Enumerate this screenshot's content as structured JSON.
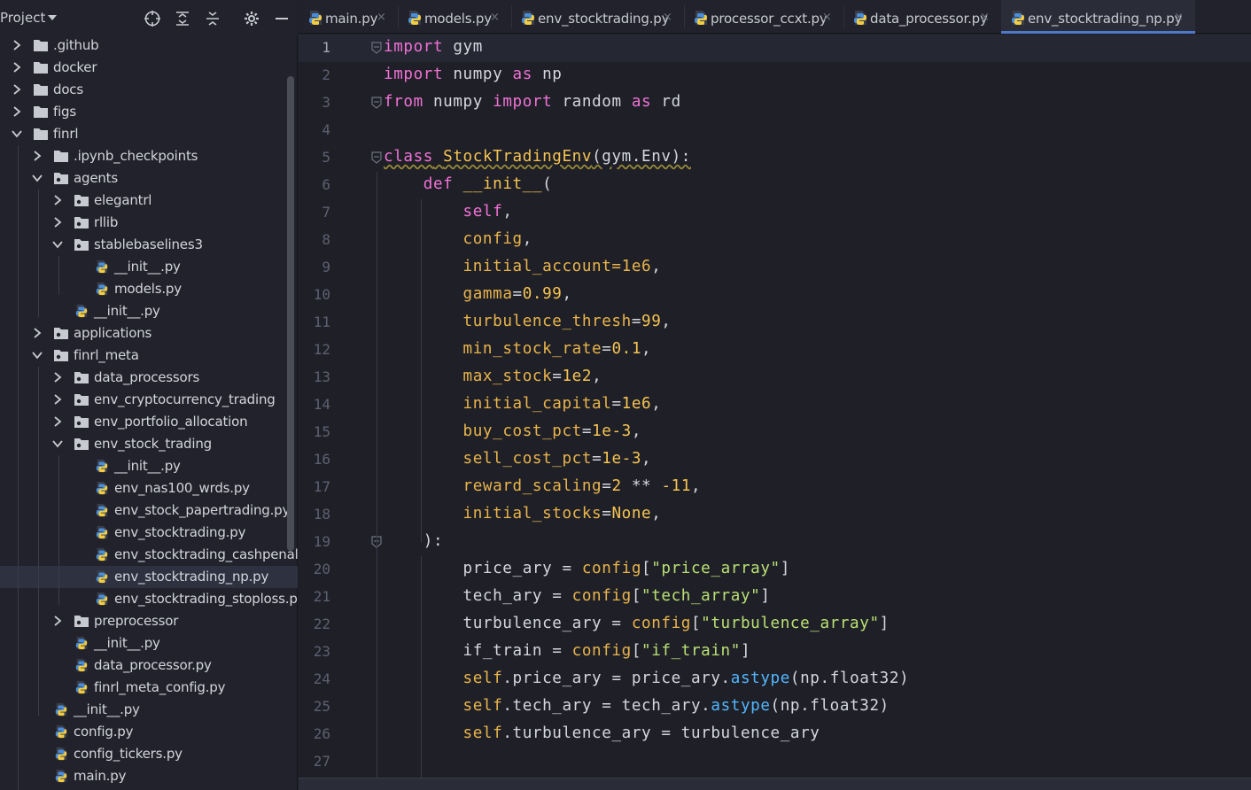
{
  "project": {
    "title": "Project",
    "tree": [
      {
        "label": ".github",
        "type": "folder",
        "level": 0,
        "expanded": false
      },
      {
        "label": "docker",
        "type": "folder",
        "level": 0,
        "expanded": false
      },
      {
        "label": "docs",
        "type": "folder",
        "level": 0,
        "expanded": false
      },
      {
        "label": "figs",
        "type": "folder",
        "level": 0,
        "expanded": false
      },
      {
        "label": "finrl",
        "type": "folder",
        "level": 0,
        "expanded": true
      },
      {
        "label": ".ipynb_checkpoints",
        "type": "folder",
        "level": 1,
        "expanded": false
      },
      {
        "label": "agents",
        "type": "package",
        "level": 1,
        "expanded": true
      },
      {
        "label": "elegantrl",
        "type": "package",
        "level": 2,
        "expanded": false
      },
      {
        "label": "rllib",
        "type": "package",
        "level": 2,
        "expanded": false
      },
      {
        "label": "stablebaselines3",
        "type": "package",
        "level": 2,
        "expanded": true
      },
      {
        "label": "__init__.py",
        "type": "python",
        "level": 3
      },
      {
        "label": "models.py",
        "type": "python",
        "level": 3
      },
      {
        "label": "__init__.py",
        "type": "python",
        "level": 2
      },
      {
        "label": "applications",
        "type": "package",
        "level": 1,
        "expanded": false
      },
      {
        "label": "finrl_meta",
        "type": "package",
        "level": 1,
        "expanded": true
      },
      {
        "label": "data_processors",
        "type": "package",
        "level": 2,
        "expanded": false
      },
      {
        "label": "env_cryptocurrency_trading",
        "type": "package",
        "level": 2,
        "expanded": false
      },
      {
        "label": "env_portfolio_allocation",
        "type": "package",
        "level": 2,
        "expanded": false
      },
      {
        "label": "env_stock_trading",
        "type": "package",
        "level": 2,
        "expanded": true
      },
      {
        "label": "__init__.py",
        "type": "python",
        "level": 3
      },
      {
        "label": "env_nas100_wrds.py",
        "type": "python",
        "level": 3
      },
      {
        "label": "env_stock_papertrading.py",
        "type": "python",
        "level": 3
      },
      {
        "label": "env_stocktrading.py",
        "type": "python",
        "level": 3
      },
      {
        "label": "env_stocktrading_cashpenalty",
        "type": "python",
        "level": 3
      },
      {
        "label": "env_stocktrading_np.py",
        "type": "python",
        "level": 3,
        "selected": true
      },
      {
        "label": "env_stocktrading_stoploss.py",
        "type": "python",
        "level": 3
      },
      {
        "label": "preprocessor",
        "type": "package",
        "level": 2,
        "expanded": false
      },
      {
        "label": "__init__.py",
        "type": "python",
        "level": 2
      },
      {
        "label": "data_processor.py",
        "type": "python",
        "level": 2
      },
      {
        "label": "finrl_meta_config.py",
        "type": "python",
        "level": 2
      },
      {
        "label": "__init__.py",
        "type": "python",
        "level": 1
      },
      {
        "label": "config.py",
        "type": "python",
        "level": 1
      },
      {
        "label": "config_tickers.py",
        "type": "python",
        "level": 1
      },
      {
        "label": "main.py",
        "type": "python",
        "level": 1
      }
    ]
  },
  "tabs": [
    {
      "label": "main.py",
      "active": false
    },
    {
      "label": "models.py",
      "active": false
    },
    {
      "label": "env_stocktrading.py",
      "active": false
    },
    {
      "label": "processor_ccxt.py",
      "active": false
    },
    {
      "label": "data_processor.py",
      "active": false
    },
    {
      "label": "env_stocktrading_np.py",
      "active": true
    }
  ],
  "tab_close_glyph": "×",
  "editor": {
    "current_line": 1,
    "lines": [
      [
        [
          "import",
          "kw"
        ],
        [
          " gym",
          ""
        ]
      ],
      [
        [
          "import",
          "kw"
        ],
        [
          " numpy ",
          ""
        ],
        [
          "as",
          "kw"
        ],
        [
          " np",
          ""
        ]
      ],
      [
        [
          "from",
          "kw"
        ],
        [
          " numpy ",
          ""
        ],
        [
          "import",
          "kw"
        ],
        [
          " random ",
          ""
        ],
        [
          "as",
          "kw"
        ],
        [
          " rd",
          ""
        ]
      ],
      [],
      [
        [
          "class",
          "kw squig"
        ],
        [
          " ",
          "squig"
        ],
        [
          "StockTradingEnv",
          "cls squig"
        ],
        [
          "(gym.Env):",
          "squig"
        ]
      ],
      [
        [
          "    ",
          ""
        ],
        [
          "def",
          "kw"
        ],
        [
          " ",
          ""
        ],
        [
          "__init__",
          "fn"
        ],
        [
          "(",
          ""
        ]
      ],
      [
        [
          "        ",
          ""
        ],
        [
          "self",
          "kw"
        ],
        [
          ",",
          ""
        ]
      ],
      [
        [
          "        ",
          ""
        ],
        [
          "config",
          "param"
        ],
        [
          ",",
          ""
        ]
      ],
      [
        [
          "        ",
          ""
        ],
        [
          "initial_account=1e6",
          "param"
        ],
        [
          ",",
          ""
        ]
      ],
      [
        [
          "        ",
          ""
        ],
        [
          "gamma",
          "param"
        ],
        [
          "=",
          ""
        ],
        [
          "0.99",
          "num"
        ],
        [
          ",",
          ""
        ]
      ],
      [
        [
          "        ",
          ""
        ],
        [
          "turbulence_thresh",
          "param"
        ],
        [
          "=",
          ""
        ],
        [
          "99",
          "num"
        ],
        [
          ",",
          ""
        ]
      ],
      [
        [
          "        ",
          ""
        ],
        [
          "min_stock_rate",
          "param"
        ],
        [
          "=",
          ""
        ],
        [
          "0.1",
          "num"
        ],
        [
          ",",
          ""
        ]
      ],
      [
        [
          "        ",
          ""
        ],
        [
          "max_stock",
          "param"
        ],
        [
          "=",
          ""
        ],
        [
          "1e2",
          "num"
        ],
        [
          ",",
          ""
        ]
      ],
      [
        [
          "        ",
          ""
        ],
        [
          "initial_capital",
          "param"
        ],
        [
          "=",
          ""
        ],
        [
          "1e6",
          "num"
        ],
        [
          ",",
          ""
        ]
      ],
      [
        [
          "        ",
          ""
        ],
        [
          "buy_cost_pct",
          "param"
        ],
        [
          "=",
          ""
        ],
        [
          "1e-3",
          "num"
        ],
        [
          ",",
          ""
        ]
      ],
      [
        [
          "        ",
          ""
        ],
        [
          "sell_cost_pct",
          "param"
        ],
        [
          "=",
          ""
        ],
        [
          "1e-3",
          "num"
        ],
        [
          ",",
          ""
        ]
      ],
      [
        [
          "        ",
          ""
        ],
        [
          "reward_scaling",
          "param"
        ],
        [
          "=",
          ""
        ],
        [
          "2",
          "num"
        ],
        [
          " ** ",
          ""
        ],
        [
          "-11",
          "num"
        ],
        [
          ",",
          ""
        ]
      ],
      [
        [
          "        ",
          ""
        ],
        [
          "initial_stocks",
          "param"
        ],
        [
          "=",
          ""
        ],
        [
          "None",
          "none"
        ],
        [
          ",",
          ""
        ]
      ],
      [
        [
          "    ",
          ""
        ],
        [
          "):",
          ""
        ]
      ],
      [
        [
          "        price_ary = ",
          ""
        ],
        [
          "config",
          "param"
        ],
        [
          "[",
          ""
        ],
        [
          "\"price_array\"",
          "str"
        ],
        [
          "]",
          ""
        ]
      ],
      [
        [
          "        tech_ary = ",
          ""
        ],
        [
          "config",
          "param"
        ],
        [
          "[",
          ""
        ],
        [
          "\"tech_array\"",
          "str"
        ],
        [
          "]",
          ""
        ]
      ],
      [
        [
          "        turbulence_ary = ",
          ""
        ],
        [
          "config",
          "param"
        ],
        [
          "[",
          ""
        ],
        [
          "\"turbulence_array\"",
          "str"
        ],
        [
          "]",
          ""
        ]
      ],
      [
        [
          "        if_train = ",
          ""
        ],
        [
          "config",
          "param"
        ],
        [
          "[",
          ""
        ],
        [
          "\"if_train\"",
          "str"
        ],
        [
          "]",
          ""
        ]
      ],
      [
        [
          "        ",
          ""
        ],
        [
          "self",
          "selfc"
        ],
        [
          ".price_ary = price_ary.",
          ""
        ],
        [
          "astype",
          "meth"
        ],
        [
          "(np.float32)",
          ""
        ]
      ],
      [
        [
          "        ",
          ""
        ],
        [
          "self",
          "selfc"
        ],
        [
          ".tech_ary = tech_ary.",
          ""
        ],
        [
          "astype",
          "meth"
        ],
        [
          "(np.float32)",
          ""
        ]
      ],
      [
        [
          "        ",
          ""
        ],
        [
          "self",
          "selfc"
        ],
        [
          ".turbulence_ary = turbulence_ary",
          ""
        ]
      ],
      []
    ]
  }
}
